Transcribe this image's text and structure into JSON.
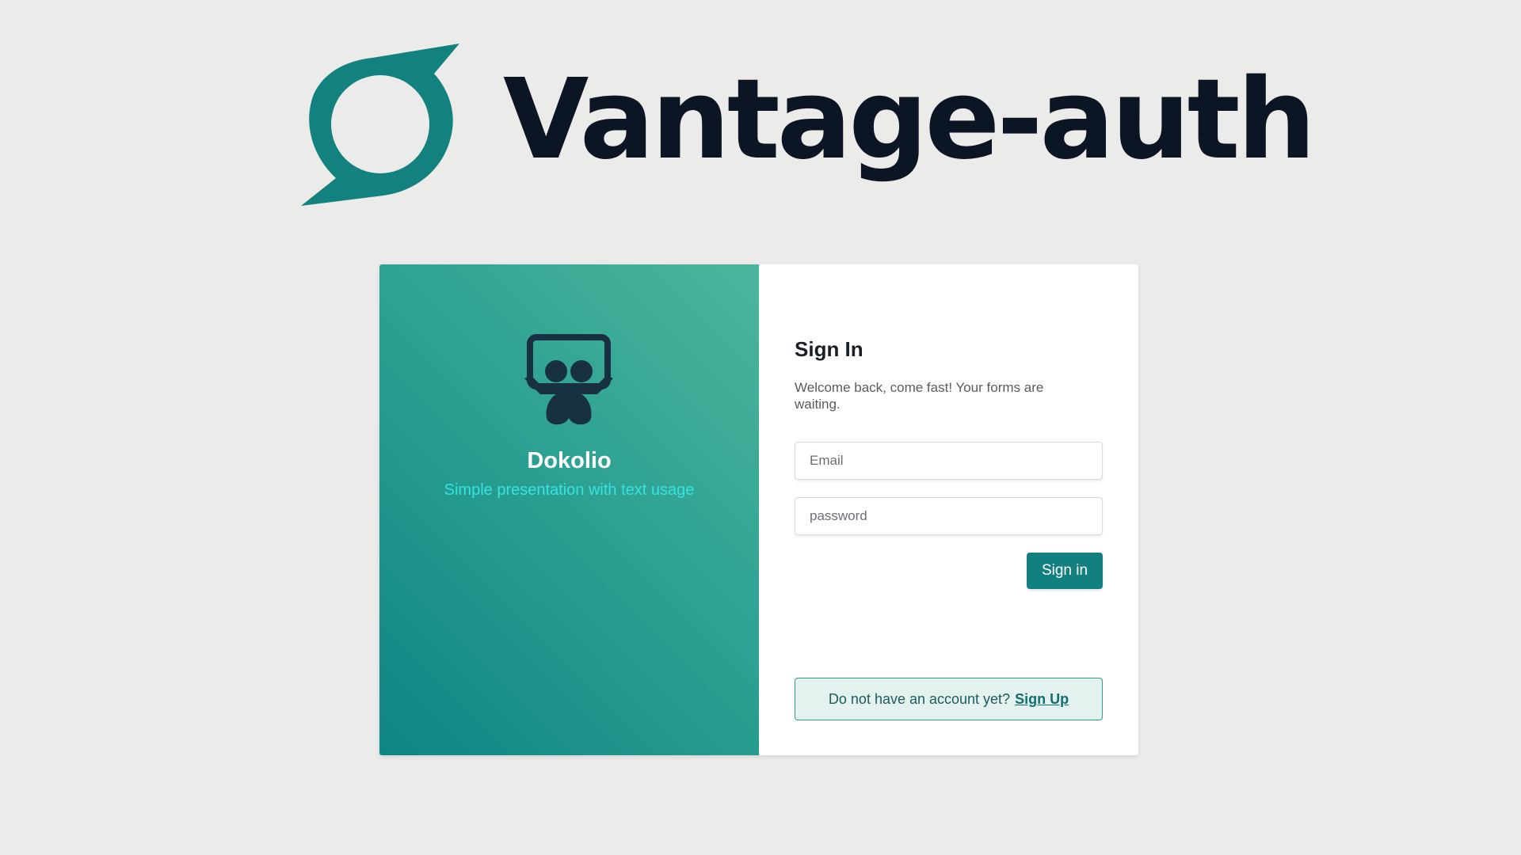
{
  "header": {
    "logo_icon": "speech-bubble-ring-icon",
    "title": "Vantage-auth",
    "brand_color": "#13827f",
    "title_color": "#0c1524"
  },
  "left_panel": {
    "icon": "presentation-people-icon",
    "app_name": "Dokolio",
    "tagline": "Simple presentation with text usage",
    "gradient_colors": [
      "#0e8584",
      "#4db59c"
    ]
  },
  "signin": {
    "title": "Sign In",
    "description": "Welcome back, come fast! Your forms are waiting.",
    "email_placeholder": "Email",
    "password_placeholder": "password",
    "submit_label": "Sign in",
    "signup_prompt": "Do not have an account yet?",
    "signup_link": "Sign Up",
    "accent_color": "#12807f"
  }
}
